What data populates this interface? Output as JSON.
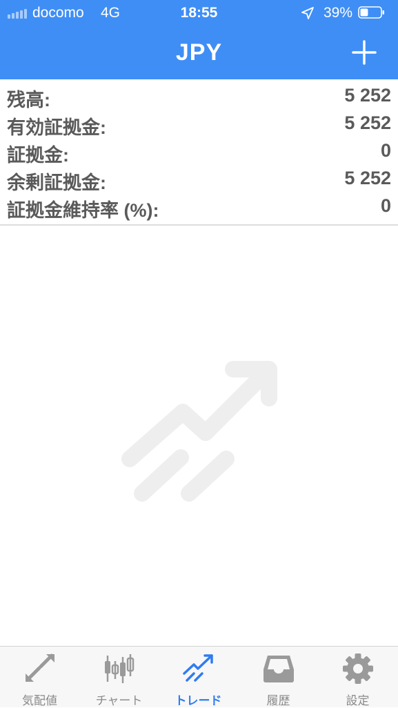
{
  "status_bar": {
    "carrier": "docomo",
    "network": "4G",
    "time": "18:55",
    "battery_percent": "39%",
    "battery_level": 0.39
  },
  "nav": {
    "title": "JPY",
    "add_icon": "plus-icon"
  },
  "account": {
    "rows": [
      {
        "label": "残高:",
        "value": "5 252"
      },
      {
        "label": "有効証拠金:",
        "value": "5 252"
      },
      {
        "label": "証拠金:",
        "value": "0"
      },
      {
        "label": "余剰証拠金:",
        "value": "5 252"
      },
      {
        "label": "証拠金維持率 (%):",
        "value": "0"
      }
    ]
  },
  "empty_state": {
    "icon": "trade-arrow-icon"
  },
  "tabs": [
    {
      "label": "気配値",
      "icon": "quotes-icon",
      "active": false
    },
    {
      "label": "チャート",
      "icon": "chart-icon",
      "active": false
    },
    {
      "label": "トレード",
      "icon": "trade-icon",
      "active": true
    },
    {
      "label": "履歴",
      "icon": "history-icon",
      "active": false
    },
    {
      "label": "設定",
      "icon": "settings-icon",
      "active": false
    }
  ],
  "colors": {
    "accent": "#3f8ef5",
    "active_tab": "#2f7cf0",
    "inactive_tab": "#8a8a8a",
    "text": "#5a5a5a",
    "placeholder_art": "#eeeeee"
  }
}
